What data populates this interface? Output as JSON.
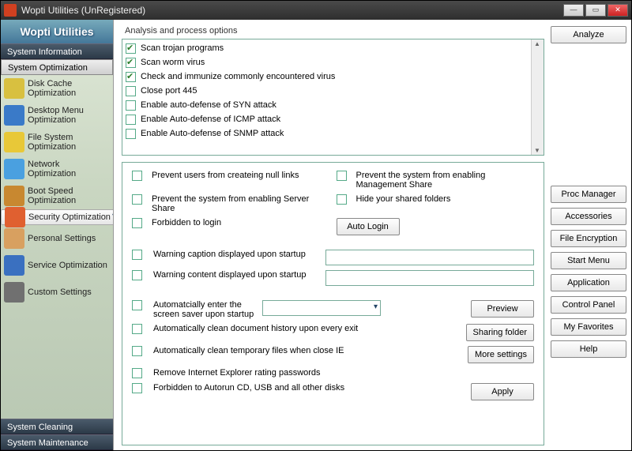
{
  "window": {
    "title": "Wopti Utilities (UnRegistered)"
  },
  "brand": "Wopti Utilities",
  "nav": {
    "headers": [
      "System Information",
      "System Optimization",
      "System Cleaning",
      "System Maintenance"
    ],
    "items": [
      {
        "label": "Disk Cache Optimization",
        "color": "#d8c040"
      },
      {
        "label": "Desktop Menu Optimization",
        "color": "#3a7ac8"
      },
      {
        "label": "File System Optimization",
        "color": "#e8c838"
      },
      {
        "label": "Network Optimization",
        "color": "#4aa0e0"
      },
      {
        "label": "Boot Speed Optimization",
        "color": "#c88830"
      },
      {
        "label": "Security Optimization",
        "color": "#e06030"
      },
      {
        "label": "Personal Settings",
        "color": "#d8a060"
      },
      {
        "label": "Service Optimization",
        "color": "#3a70c0"
      },
      {
        "label": "Custom Settings",
        "color": "#707070"
      }
    ]
  },
  "section_title": "Analysis and process options",
  "scanlist": [
    {
      "label": "Scan trojan programs",
      "checked": true
    },
    {
      "label": "Scan worm virus",
      "checked": true
    },
    {
      "label": "Check and immunize commonly encountered virus",
      "checked": true
    },
    {
      "label": "Close port 445",
      "checked": false
    },
    {
      "label": "Enable auto-defense of SYN attack",
      "checked": false
    },
    {
      "label": "Enable Auto-defense of ICMP attack",
      "checked": false
    },
    {
      "label": "Enable Auto-defense of SNMP attack",
      "checked": false
    }
  ],
  "opts": {
    "prevent_null_links": "Prevent users from  createing null links",
    "prevent_mgmt": "Prevent the system from enabling Management Share",
    "prevent_server": "Prevent the system from enabling Server Share",
    "hide_shared": "Hide your shared folders",
    "forbid_login": "Forbidden to login",
    "auto_login_btn": "Auto Login",
    "warn_caption": "Warning caption displayed upon startup",
    "warn_content": "Warning content displayed upon startup",
    "auto_ss": "Automatcially enter the screen saver upon startup",
    "auto_clean_doc": "Automatically clean document history upon every exit",
    "auto_clean_tmp": "Automatically clean temporary files when close IE",
    "remove_ie": "Remove Internet Explorer rating passwords",
    "forbid_autorun": "Forbidden to Autorun CD, USB and all other disks",
    "preview_btn": "Preview",
    "sharing_btn": "Sharing folder",
    "more_btn": "More settings",
    "apply_btn": "Apply"
  },
  "rightbtns": {
    "analyze": "Analyze",
    "proc": "Proc Manager",
    "acc": "Accessories",
    "enc": "File Encryption",
    "start": "Start Menu",
    "app": "Application",
    "cp": "Control Panel",
    "fav": "My Favorites",
    "help": "Help"
  }
}
